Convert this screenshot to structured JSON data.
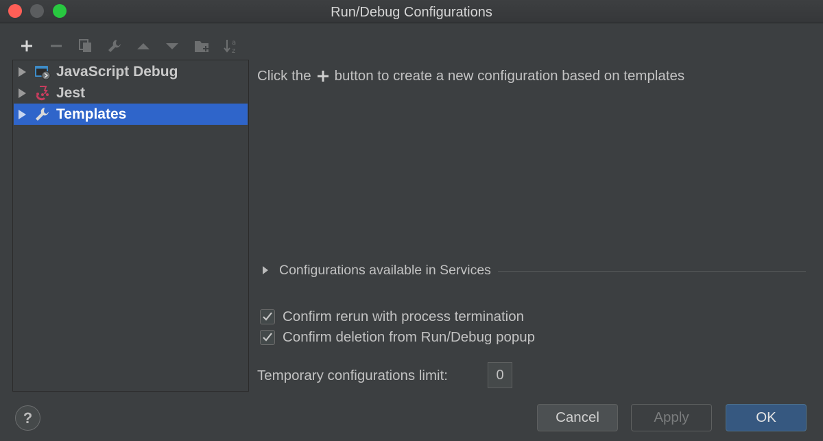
{
  "window": {
    "title": "Run/Debug Configurations"
  },
  "toolbar": {
    "buttons": [
      {
        "name": "add",
        "icon": "plus-icon"
      },
      {
        "name": "remove",
        "icon": "minus-icon"
      },
      {
        "name": "copy",
        "icon": "copy-icon"
      },
      {
        "name": "edit-templates",
        "icon": "wrench-icon"
      },
      {
        "name": "move-up",
        "icon": "arrow-up-icon"
      },
      {
        "name": "move-down",
        "icon": "arrow-down-icon"
      },
      {
        "name": "folder",
        "icon": "folder-icon"
      },
      {
        "name": "sort",
        "icon": "sort-alpha-icon"
      }
    ]
  },
  "tree": {
    "items": [
      {
        "label": "JavaScript Debug",
        "icon": "javascript-debug-icon",
        "selected": false
      },
      {
        "label": "Jest",
        "icon": "jest-icon",
        "selected": false
      },
      {
        "label": "Templates",
        "icon": "wrench-icon",
        "selected": true
      }
    ]
  },
  "main": {
    "hint_before": "Click the",
    "hint_after": "button to create a new configuration based on templates",
    "services_label": "Configurations available in Services",
    "checkboxes": [
      {
        "label": "Confirm rerun with process termination",
        "checked": true
      },
      {
        "label": "Confirm deletion from Run/Debug popup",
        "checked": true
      }
    ],
    "temp_limit_label": "Temporary configurations limit:",
    "temp_limit_value": "0"
  },
  "footer": {
    "help_label": "?",
    "cancel_label": "Cancel",
    "apply_label": "Apply",
    "ok_label": "OK"
  },
  "colors": {
    "background": "#3c3f41",
    "selection": "#2f65ca",
    "ok_button": "#365880",
    "close": "#ff5f57",
    "maximize": "#28c840"
  }
}
